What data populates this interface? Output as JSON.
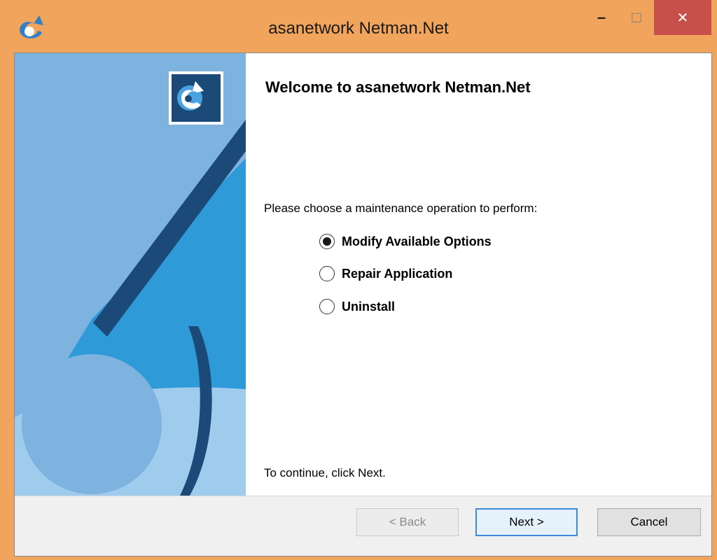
{
  "window": {
    "title": "asanetwork Netman.Net",
    "minimize_glyph": "–",
    "maximize_glyph": "□",
    "close_glyph": "✕"
  },
  "main": {
    "heading": "Welcome to asanetwork Netman.Net",
    "instruction": "Please choose a maintenance operation to perform:",
    "options": [
      {
        "label": "Modify Available Options",
        "selected": true
      },
      {
        "label": "Repair Application",
        "selected": false
      },
      {
        "label": "Uninstall",
        "selected": false
      }
    ],
    "continue_hint": "To continue, click Next."
  },
  "footer": {
    "back_label": "< Back",
    "next_label": "Next >",
    "cancel_label": "Cancel"
  },
  "colors": {
    "titlebar": "#f0a45c",
    "close_button": "#c7504a",
    "panel_light": "#7fb3df",
    "panel_bright": "#2f9ad8",
    "panel_dark": "#1b4a78",
    "default_button_border": "#3c8ad9"
  }
}
